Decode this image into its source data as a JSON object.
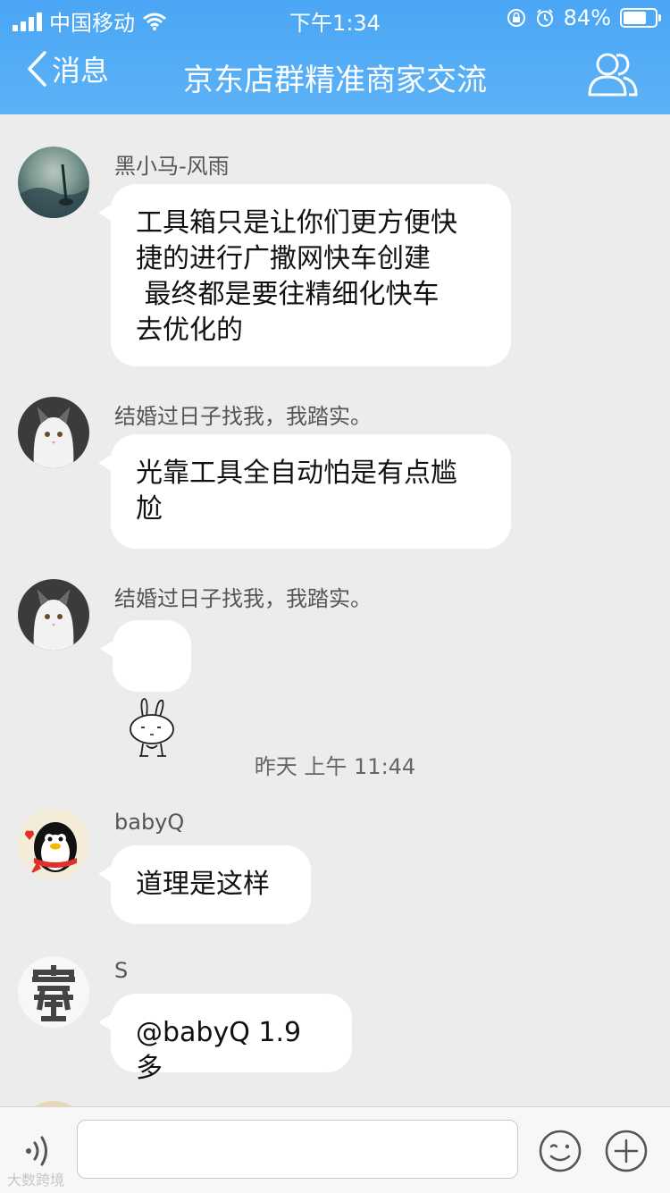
{
  "status_bar": {
    "carrier": "中国移动",
    "time": "下午1:34",
    "battery": "84%",
    "battery_level": 0.84
  },
  "nav": {
    "back_label": "消息",
    "title": "京东店群精准商家交流"
  },
  "messages": [
    {
      "sender": "黑小马-风雨",
      "text": "工具箱只是让你们更方便快\n捷的进行广撒网快车创建\n 最终都是要往精细化快车\n去优化的"
    },
    {
      "sender": "结婚过日子找我，我踏实。",
      "text": "光靠工具全自动怕是有点尴\n尬"
    },
    {
      "sender": "结婚过日子找我，我踏实。",
      "sticker": "bunny-sticker"
    },
    {
      "sender": "babyQ",
      "text": "道理是这样"
    },
    {
      "sender": "S",
      "text": "@babyQ 1.9 多"
    }
  ],
  "timestamp": "昨天 上午 11:44",
  "input": {
    "placeholder": ""
  },
  "watermark": "大数跨境",
  "colors": {
    "header": "#4aa6f5",
    "chat_background": "#ececec",
    "bubble": "#ffffff"
  }
}
